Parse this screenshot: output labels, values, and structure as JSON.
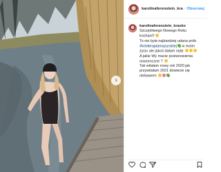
{
  "post": {
    "username": "karolinaferenstein_kras",
    "follow_label": "· Obserwuj"
  },
  "caption": {
    "username": "karolinaferenstein_krasko",
    "line1": "Szczęśliwego Nowego Roku",
    "line2": "kochani!!",
    "line3": "To nie była najbardziej udana prób",
    "hashtag": "#krioterapiamazurskiej",
    "line4_rest": " w moim",
    "line5": "życiu ale jakoś dałam radę",
    "line6": "A jakie Wy macie postanowienia",
    "line7": "noworoczne ?",
    "line8": "Tak witałam nowy rok 2020 jak",
    "line9": "przywitałam 2021 dowiecie się",
    "line10": "niebawem"
  },
  "icons": {
    "avatar": "profile-avatar",
    "next": "chevron-right-icon",
    "like": "heart-icon",
    "comment": "comment-icon",
    "share": "share-icon",
    "save": "bookmark-icon"
  },
  "colors": {
    "link": "#00376b",
    "follow": "#3897f0",
    "text": "#262626"
  }
}
